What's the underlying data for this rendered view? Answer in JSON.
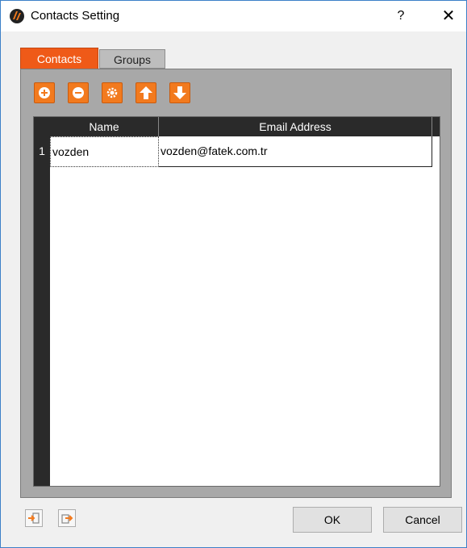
{
  "window": {
    "title": "Contacts Setting",
    "help": "?",
    "close": "✕"
  },
  "tabs": [
    {
      "label": "Contacts",
      "active": true
    },
    {
      "label": "Groups",
      "active": false
    }
  ],
  "toolbar": {
    "buttons": [
      {
        "icon": "add-icon"
      },
      {
        "icon": "remove-icon"
      },
      {
        "icon": "gear-icon"
      },
      {
        "icon": "arrow-up-icon"
      },
      {
        "icon": "arrow-down-icon"
      }
    ],
    "accent": "#f27a1e"
  },
  "table": {
    "columns": [
      "Name",
      "Email Address"
    ],
    "rows": [
      {
        "num": "1",
        "name": "vozden",
        "email": "vozden@fatek.com.tr"
      }
    ]
  },
  "footer": {
    "import_icon": "import-icon",
    "export_icon": "export-icon",
    "ok": "OK",
    "cancel": "Cancel"
  }
}
